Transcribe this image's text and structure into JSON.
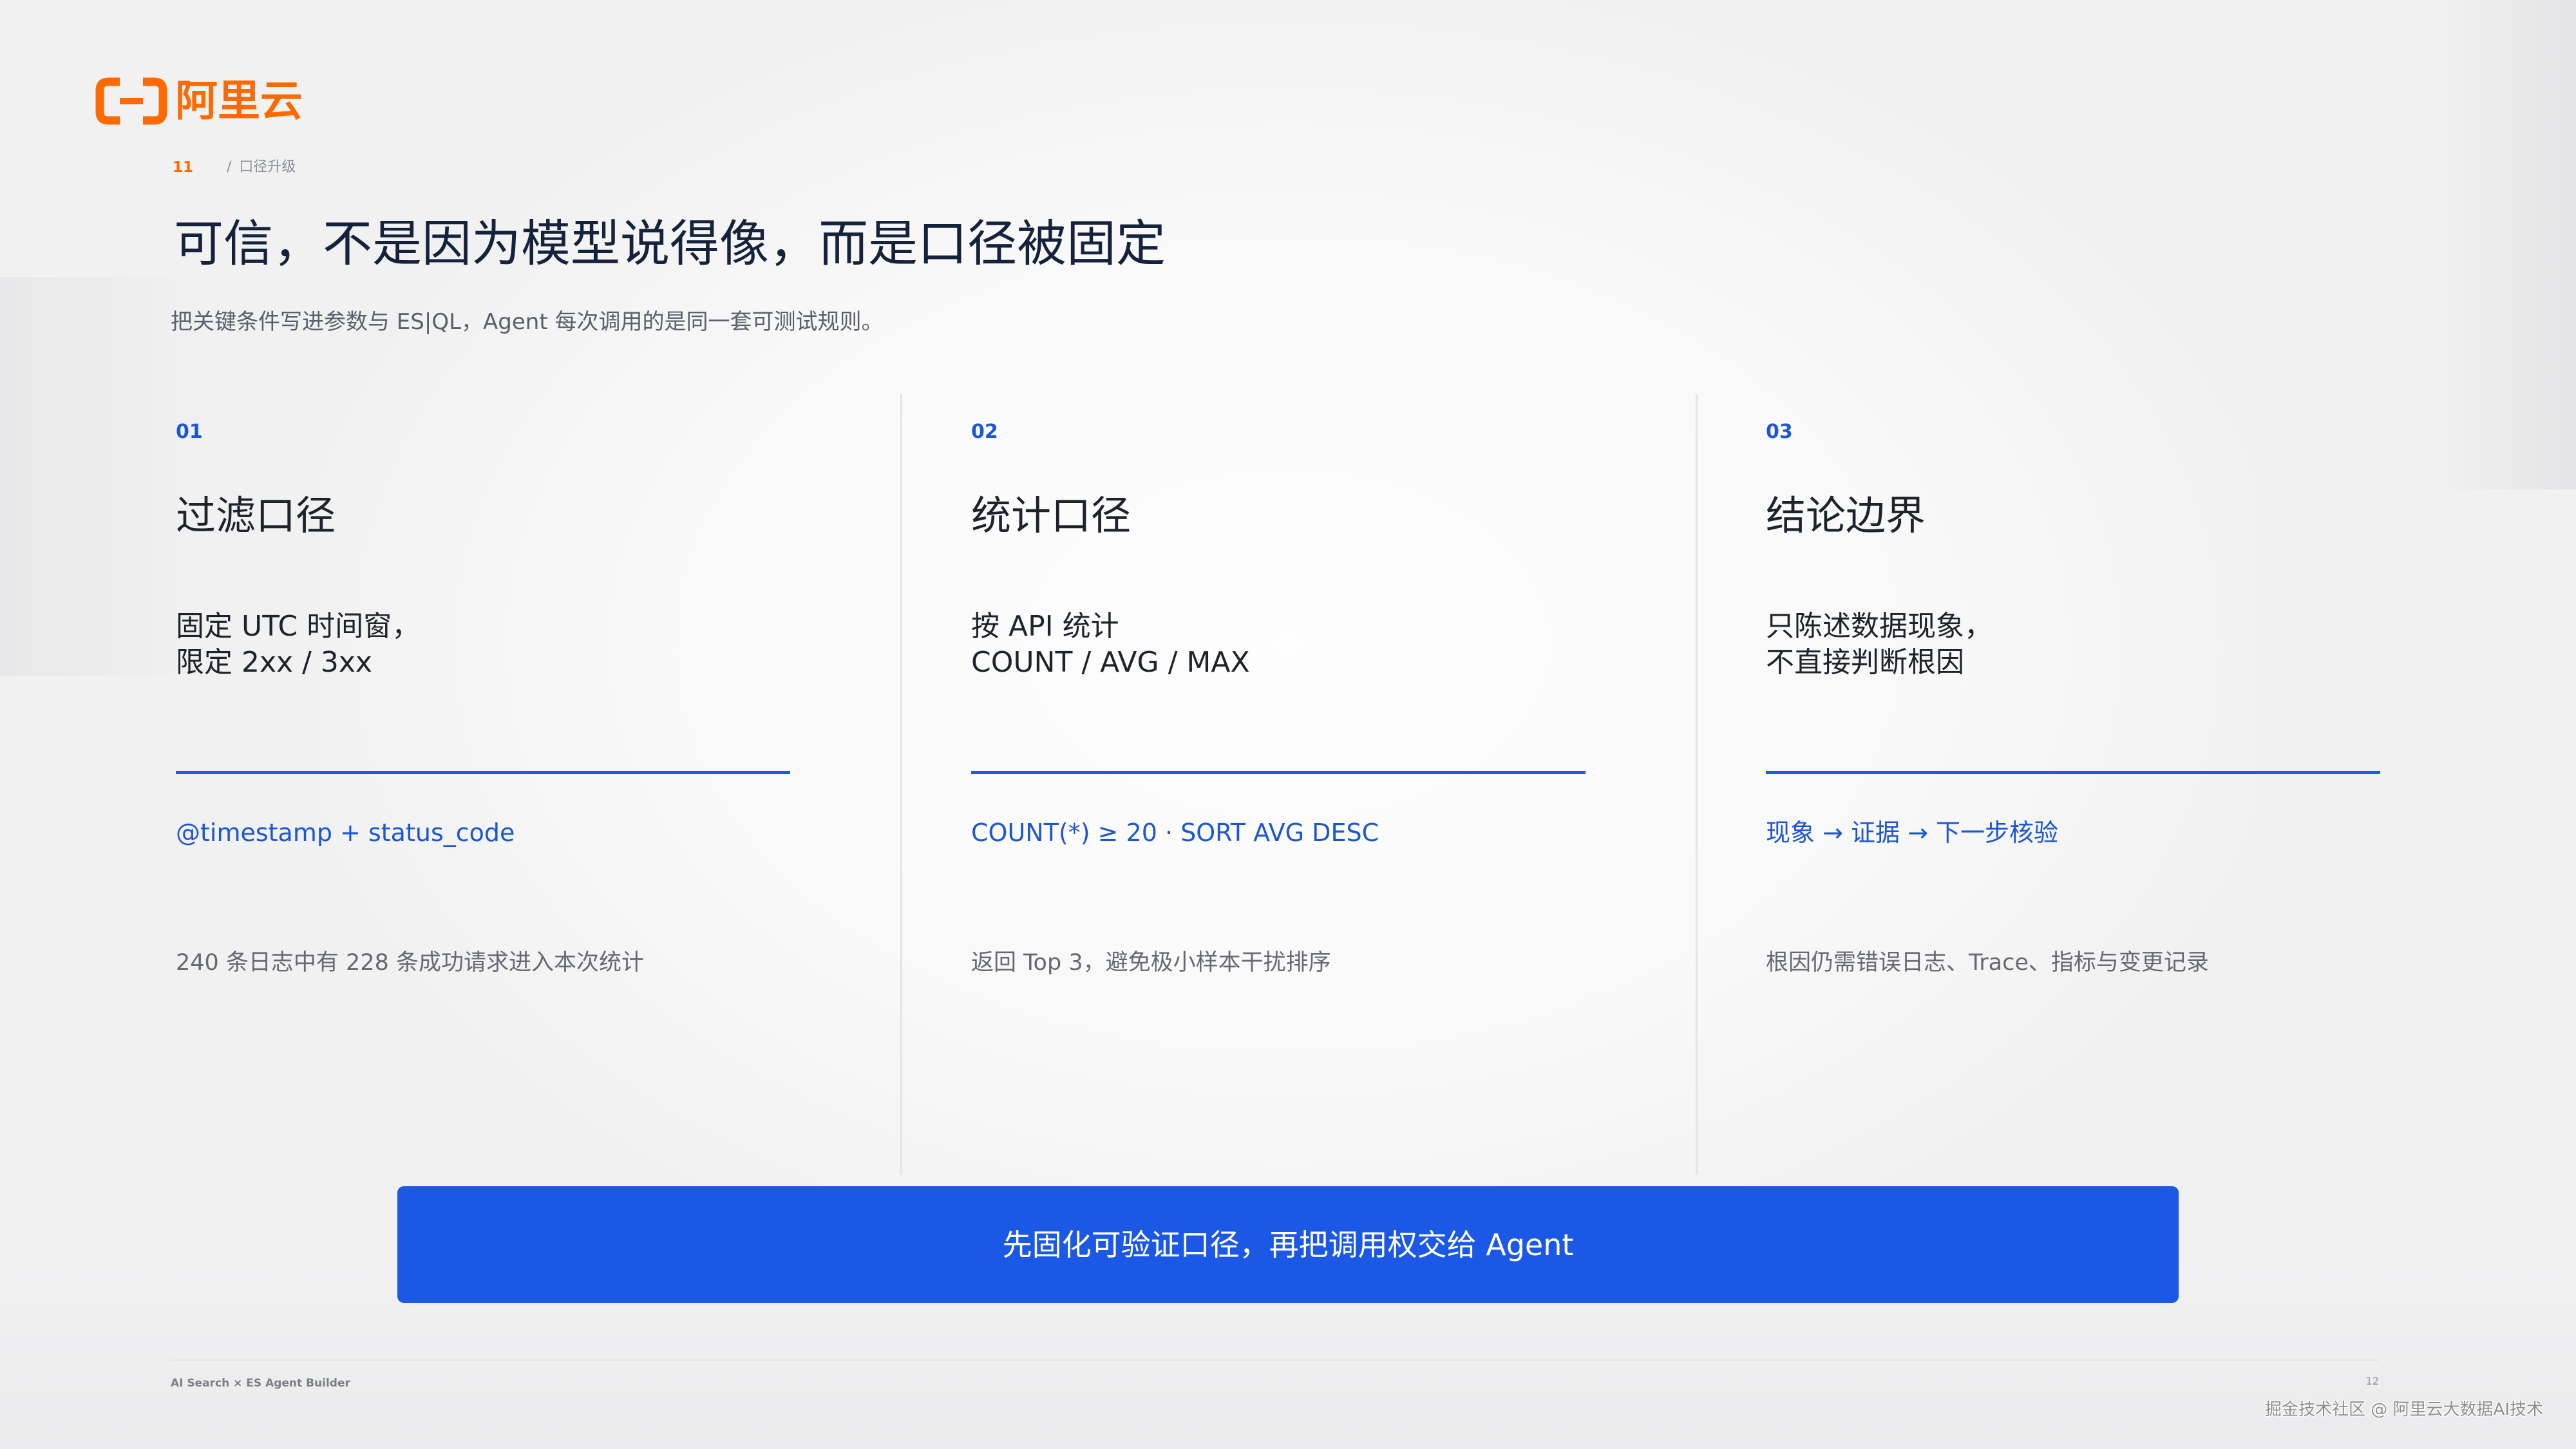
{
  "brand": {
    "logo_icon": "alibaba-cloud-logo-icon",
    "logo_text": "阿里云"
  },
  "breadcrumb": {
    "page_number": "11",
    "separator": "/",
    "section": "口径升级"
  },
  "title": "可信，不是因为模型说得像，而是口径被固定",
  "subtitle": "把关键条件写进参数与 ES|QL，Agent 每次调用的是同一套可测试规则。",
  "columns": [
    {
      "number": "01",
      "heading": "过滤口径",
      "body_lines": [
        "固定 UTC 时间窗，",
        "限定 2xx / 3xx"
      ],
      "formula": "@timestamp + status_code",
      "note": "240 条日志中有 228 条成功请求进入本次统计"
    },
    {
      "number": "02",
      "heading": "统计口径",
      "body_lines": [
        "按 API 统计",
        "COUNT / AVG / MAX"
      ],
      "formula": "COUNT(*) ≥ 20 · SORT AVG DESC",
      "note": "返回 Top 3，避免极小样本干扰排序"
    },
    {
      "number": "03",
      "heading": "结论边界",
      "body_lines": [
        "只陈述数据现象，",
        "不直接判断根因"
      ],
      "formula": "现象 → 证据 → 下一步核验",
      "note": "根因仍需错误日志、Trace、指标与变更记录"
    }
  ],
  "banner": {
    "text": "先固化可验证口径，再把调用权交给 Agent"
  },
  "footer": {
    "left": "AI Search × ES Agent Builder",
    "page_number": "12"
  },
  "watermark": "掘金技术社区 @ 阿里云大数据AI技术",
  "colors": {
    "brand_orange": "#ff6a00",
    "accent_blue": "#1d56d2",
    "banner_blue": "#1b58e6",
    "title_navy": "#15223b"
  }
}
